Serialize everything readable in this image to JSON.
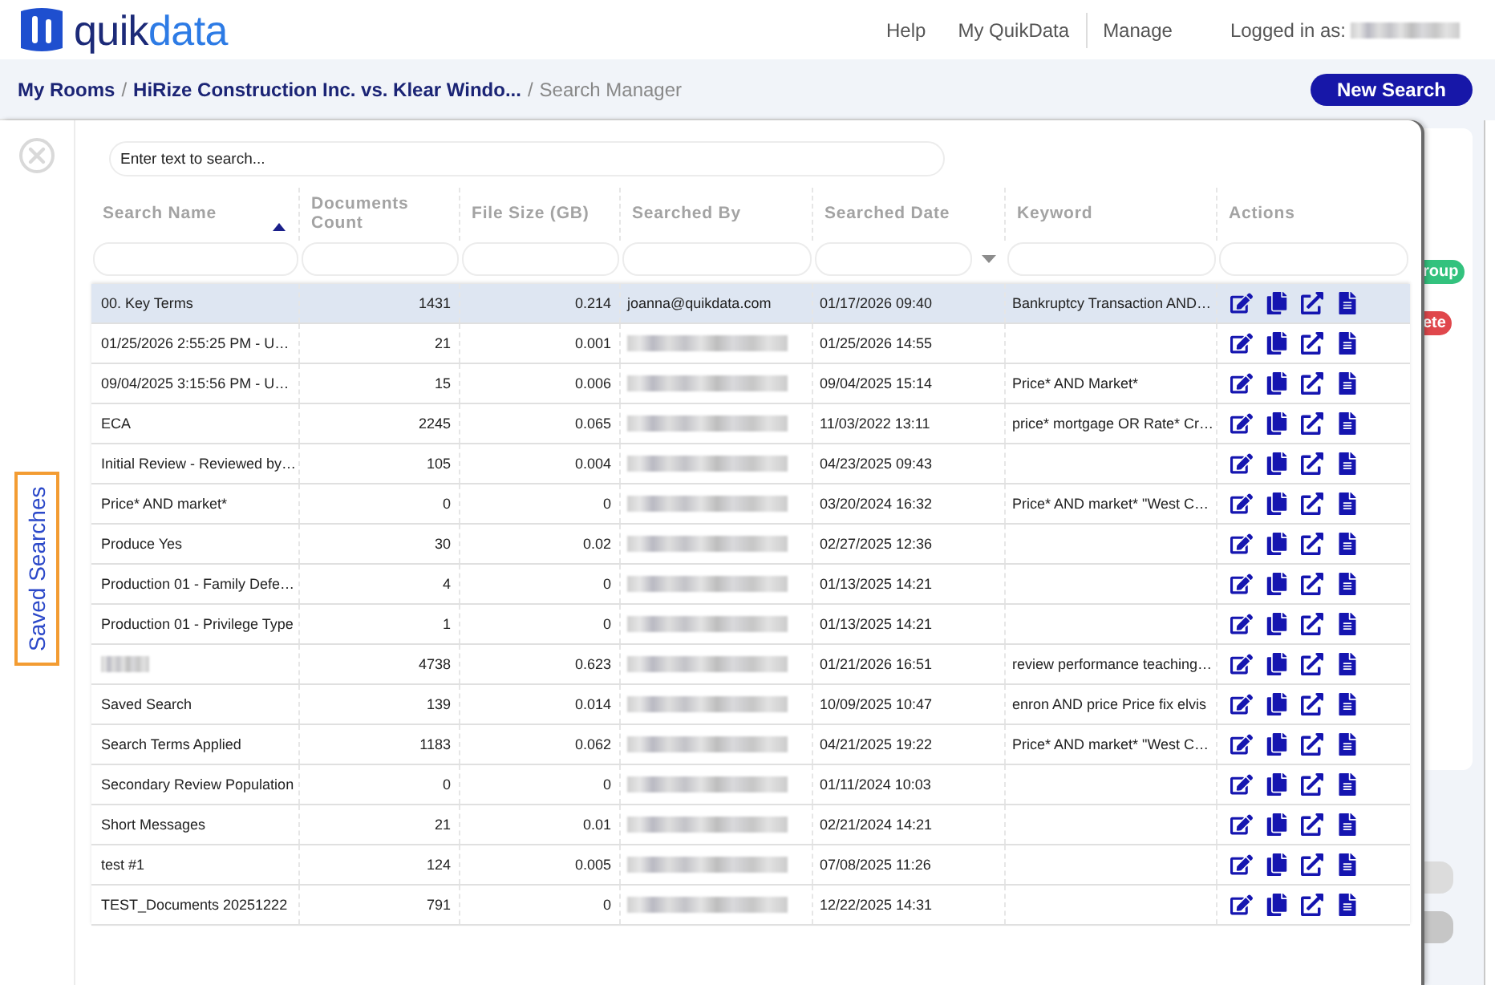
{
  "header": {
    "logo": {
      "primary": "quik",
      "secondary": "data"
    },
    "nav": [
      {
        "kind": "link",
        "label": "Help"
      },
      {
        "kind": "link",
        "label": "My QuikData"
      },
      {
        "kind": "divider"
      },
      {
        "kind": "link",
        "label": "Manage"
      }
    ],
    "user": {
      "label": "Logged in as:",
      "name_redacted": true
    }
  },
  "breadcrumb": [
    {
      "kind": "link",
      "label": "My Rooms"
    },
    {
      "kind": "separator",
      "label": "/"
    },
    {
      "kind": "link",
      "label": "HiRize Construction Inc. vs. Klear Windo..."
    },
    {
      "kind": "separator",
      "label": "/"
    },
    {
      "kind": "current",
      "label": "Search Manager"
    }
  ],
  "new_search_button": "New Search",
  "side_tab": {
    "label": "Saved Searches",
    "selected": true
  },
  "search": {
    "placeholder": "Enter text to search..."
  },
  "table": {
    "columns": [
      {
        "label": "Search Name",
        "kind": "text",
        "sorted": true,
        "filter_dropdown": false
      },
      {
        "label": "Documents Count",
        "kind": "number",
        "sorted": false,
        "filter_dropdown": false
      },
      {
        "label": "File Size (GB)",
        "kind": "number",
        "sorted": false,
        "filter_dropdown": false
      },
      {
        "label": "Searched By",
        "kind": "text",
        "sorted": false,
        "filter_dropdown": false
      },
      {
        "label": "Searched Date",
        "kind": "text",
        "sorted": false,
        "filter_dropdown": true
      },
      {
        "label": "Keyword",
        "kind": "text",
        "sorted": false,
        "filter_dropdown": false
      },
      {
        "label": "Actions",
        "kind": "actions",
        "sorted": false,
        "filter_dropdown": false
      }
    ],
    "rows": [
      {
        "selected": true,
        "name": "00. Key Terms",
        "documents_count": "1431",
        "file_size": "0.214",
        "searched_by": "joanna@quikdata.com",
        "searched_date": "01/17/2026 09:40",
        "keyword": "Bankruptcy Transaction AND…"
      },
      {
        "selected": false,
        "name": "01/25/2026 2:55:25 PM - U…",
        "documents_count": "21",
        "file_size": "0.001",
        "searched_by_redacted": true,
        "searched_date": "01/25/2026 14:55"
      },
      {
        "selected": false,
        "name": "09/04/2025 3:15:56 PM - U…",
        "documents_count": "15",
        "file_size": "0.006",
        "searched_by_redacted": true,
        "searched_date": "09/04/2025 15:14",
        "keyword": "Price* AND Market*"
      },
      {
        "selected": false,
        "name": "ECA",
        "documents_count": "2245",
        "file_size": "0.065",
        "searched_by_redacted": true,
        "searched_date": "11/03/2022 13:11",
        "keyword": "price* mortgage OR Rate* Cr…"
      },
      {
        "selected": false,
        "name": "Initial Review - Reviewed by…",
        "documents_count": "105",
        "file_size": "0.004",
        "searched_by_redacted": true,
        "searched_date": "04/23/2025 09:43"
      },
      {
        "selected": false,
        "name": "Price* AND market*",
        "documents_count": "0",
        "file_size": "0",
        "searched_by_redacted": true,
        "searched_date": "03/20/2024 16:32",
        "keyword": "Price* AND market* \"West C…"
      },
      {
        "selected": false,
        "name": "Produce Yes",
        "documents_count": "30",
        "file_size": "0.02",
        "searched_by_redacted": true,
        "searched_date": "02/27/2025 12:36"
      },
      {
        "selected": false,
        "name": "Production 01 - Family Defe…",
        "documents_count": "4",
        "file_size": "0",
        "searched_by_redacted": true,
        "searched_date": "01/13/2025 14:21"
      },
      {
        "selected": false,
        "name": "Production 01 - Privilege Type",
        "documents_count": "1",
        "file_size": "0",
        "searched_by_redacted": true,
        "searched_date": "01/13/2025 14:21"
      },
      {
        "selected": false,
        "name_redacted": true,
        "documents_count": "4738",
        "file_size": "0.623",
        "searched_by_redacted": true,
        "searched_date": "01/21/2026 16:51",
        "keyword": "review performance teaching…"
      },
      {
        "selected": false,
        "name": "Saved Search",
        "documents_count": "139",
        "file_size": "0.014",
        "searched_by_redacted": true,
        "searched_date": "10/09/2025 10:47",
        "keyword": "enron AND price Price fix elvis"
      },
      {
        "selected": false,
        "name": "Search Terms Applied",
        "documents_count": "1183",
        "file_size": "0.062",
        "searched_by_redacted": true,
        "searched_date": "04/21/2025 19:22",
        "keyword": "Price* AND market* \"West C…"
      },
      {
        "selected": false,
        "name": "Secondary Review Population",
        "documents_count": "0",
        "file_size": "0",
        "searched_by_redacted": true,
        "searched_date": "01/11/2024 10:03"
      },
      {
        "selected": false,
        "name": "Short Messages",
        "documents_count": "21",
        "file_size": "0.01",
        "searched_by_redacted": true,
        "searched_date": "02/21/2024 14:21"
      },
      {
        "selected": false,
        "name": "test #1",
        "documents_count": "124",
        "file_size": "0.005",
        "searched_by_redacted": true,
        "searched_date": "07/08/2025 11:26"
      },
      {
        "selected": false,
        "name": "TEST_Documents 20251222",
        "documents_count": "791",
        "file_size": "0",
        "searched_by_redacted": true,
        "searched_date": "12/22/2025 14:31"
      }
    ]
  },
  "background_page": {
    "badges": [
      {
        "label": "roup",
        "color": "#33c27e"
      },
      {
        "label": "ete",
        "color": "#e0474c"
      }
    ]
  }
}
